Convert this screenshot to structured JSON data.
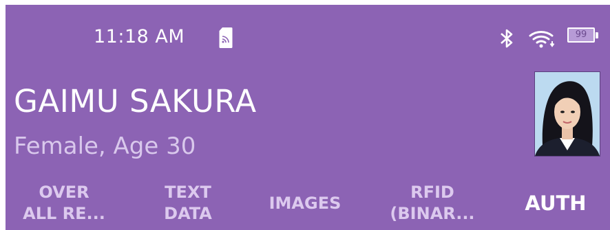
{
  "status_bar": {
    "time": "11:18 AM",
    "battery_level": "99",
    "icons": [
      "sim-card-icon",
      "bluetooth-icon",
      "wifi-icon",
      "battery-icon"
    ]
  },
  "header": {
    "name": "GAIMU SAKURA",
    "subtitle": "Female, Age 30",
    "photo_icon": "portrait-photo"
  },
  "tabs": [
    {
      "label": "OVER\nALL RE..."
    },
    {
      "label": "TEXT\nDATA"
    },
    {
      "label": "IMAGES"
    },
    {
      "label": "RFID\n(BINAR..."
    },
    {
      "label": "AUTH",
      "active": true
    }
  ],
  "colors": {
    "app_bar": "#8c63b4",
    "tab_inactive": "#dcc9ee",
    "tab_active": "#ffffff",
    "subtitle": "#d9c8ec"
  }
}
